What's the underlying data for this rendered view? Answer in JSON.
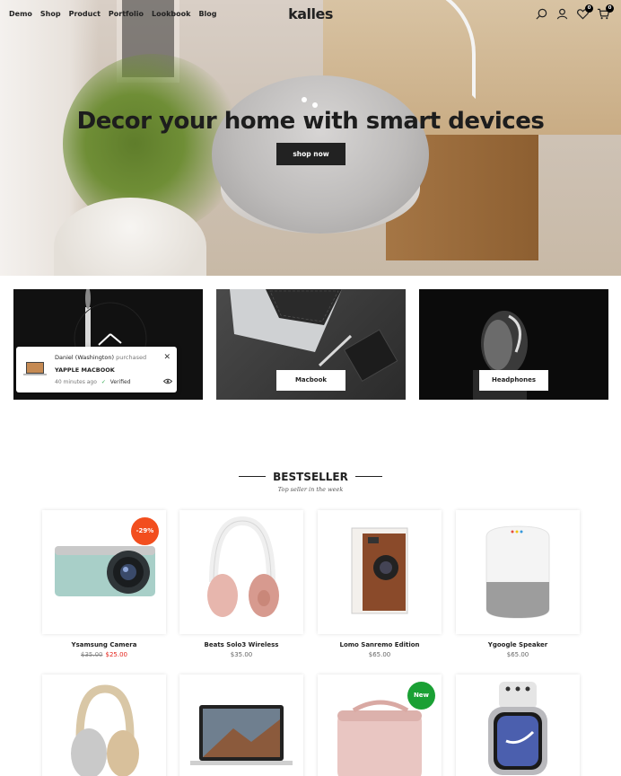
{
  "header": {
    "nav": [
      "Demo",
      "Shop",
      "Product",
      "Portfolio",
      "Lookbook",
      "Blog"
    ],
    "logo": "kalles",
    "wishlist_count": "0",
    "cart_count": "0",
    "icons": [
      "search-icon",
      "account-icon",
      "wishlist-icon",
      "cart-icon"
    ]
  },
  "hero": {
    "title": "Decor your home with smart devices",
    "button": "shop now"
  },
  "categories": [
    {
      "label": ""
    },
    {
      "label": "Macbook"
    },
    {
      "label": "Headphones"
    }
  ],
  "notification": {
    "buyer": "Daniel (Washington)",
    "action": "purchased",
    "product": "YAPPLE MACBOOK",
    "time": "40 minutes ago",
    "verified": "Verified"
  },
  "bestseller": {
    "title": "BESTSELLER",
    "subtitle": "Top seller in the week"
  },
  "products": [
    {
      "name": "Ysamsung Camera",
      "price_old": "$35.00",
      "price": "$25.00",
      "badge": "-29%"
    },
    {
      "name": "Beats Solo3 Wireless",
      "price": "$35.00"
    },
    {
      "name": "Lomo Sanremo Edition",
      "price": "$65.00"
    },
    {
      "name": "Ygoogle Speaker",
      "price": "$65.00"
    },
    {
      "name": "",
      "price": ""
    },
    {
      "name": "",
      "price": ""
    },
    {
      "name": "",
      "price": "",
      "badge": "New"
    },
    {
      "name": "",
      "price": ""
    }
  ],
  "colors": {
    "accent_dark": "#222222",
    "sale_badge": "#f24e1e",
    "new_badge": "#1aa034",
    "sale_price": "#e4231b"
  }
}
